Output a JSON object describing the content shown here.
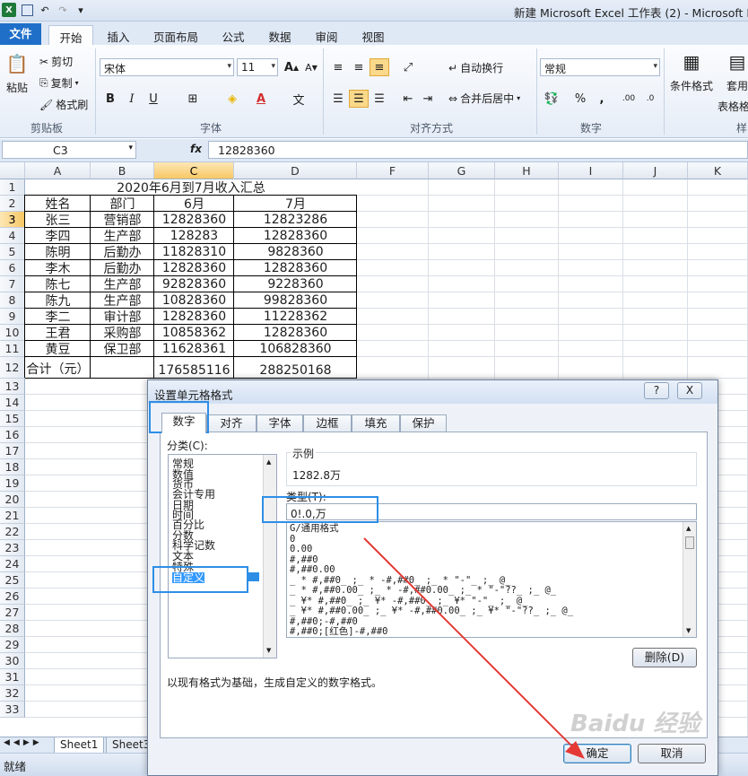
{
  "window": {
    "title": "新建 Microsoft Excel 工作表 (2) - Microsoft E"
  },
  "ribbon": {
    "tabs": [
      "文件",
      "开始",
      "插入",
      "页面布局",
      "公式",
      "数据",
      "审阅",
      "视图"
    ],
    "clipboard": {
      "paste": "粘贴",
      "cut": "剪切",
      "copy": "复制",
      "format_painter": "格式刷",
      "label": "剪贴板"
    },
    "font": {
      "name": "宋体",
      "size": "11",
      "label": "字体",
      "bold": "B",
      "italic": "I",
      "underline": "U"
    },
    "alignment": {
      "wrap": "自动换行",
      "merge": "合并后居中",
      "label": "对齐方式"
    },
    "number": {
      "format": "常规",
      "percent": "%",
      "comma": ",",
      "label": "数字"
    },
    "styles": {
      "conditional": "条件格式",
      "table": "套用",
      "table2": "表格格",
      "label": "样"
    }
  },
  "formula_bar": {
    "cell_ref": "C3",
    "fx": "fx",
    "value": "12828360"
  },
  "columns": [
    "A",
    "B",
    "C",
    "D",
    "F",
    "G",
    "H",
    "I",
    "J",
    "K"
  ],
  "rows": [
    "1",
    "2",
    "3",
    "4",
    "5",
    "6",
    "7",
    "8",
    "9",
    "10",
    "11",
    "12",
    "13",
    "14",
    "15",
    "16",
    "17",
    "18",
    "19",
    "20",
    "21",
    "22",
    "23",
    "24",
    "25",
    "26",
    "27",
    "28",
    "29",
    "30",
    "31",
    "32",
    "33"
  ],
  "sheet": {
    "title": "2020年6月到7月收入汇总",
    "headers": [
      "姓名",
      "部门",
      "6月",
      "7月"
    ],
    "data": [
      [
        "张三",
        "营销部",
        "12828360",
        "12823286"
      ],
      [
        "李四",
        "生产部",
        "128283",
        "12828360"
      ],
      [
        "陈明",
        "后勤办",
        "11828310",
        "9828360"
      ],
      [
        "李木",
        "后勤办",
        "12828360",
        "12828360"
      ],
      [
        "陈七",
        "生产部",
        "92828360",
        "9228360"
      ],
      [
        "陈九",
        "生产部",
        "10828360",
        "99828360"
      ],
      [
        "李二",
        "审计部",
        "12828360",
        "11228362"
      ],
      [
        "王君",
        "采购部",
        "10858362",
        "12828360"
      ],
      [
        "黄豆",
        "保卫部",
        "11628361",
        "106828360"
      ]
    ],
    "total": [
      "合计（元）",
      "",
      "176585116",
      "288250168"
    ]
  },
  "sheet_tabs": [
    "Sheet1",
    "Sheet3"
  ],
  "status": {
    "ready": "就绪"
  },
  "dialog": {
    "title": "设置单元格格式",
    "help": "?",
    "close": "X",
    "tabs": [
      "数字",
      "对齐",
      "字体",
      "边框",
      "填充",
      "保护"
    ],
    "category_label": "分类(C):",
    "categories": [
      "常规",
      "数值",
      "货币",
      "会计专用",
      "日期",
      "时间",
      "百分比",
      "分数",
      "科学记数",
      "文本",
      "特殊",
      "自定义"
    ],
    "sample_label": "示例",
    "sample_value": "1282.8万",
    "type_label": "类型(T):",
    "type_value": "0!.0,万",
    "formats": [
      "G/通用格式",
      "0",
      "0.00",
      "#,##0",
      "#,##0.00",
      "_ * #,##0_ ;_ * -#,##0_ ;_ * \"-\"_ ;_ @_",
      "_ * #,##0.00_ ;_ * -#,##0.00_ ;_ * \"-\"??_ ;_ @_",
      "_ ¥* #,##0_ ;_ ¥* -#,##0_ ;_ ¥* \"-\"_ ;_ @_",
      "_ ¥* #,##0.00_ ;_ ¥* -#,##0.00_ ;_ ¥* \"-\"??_ ;_ @_",
      "#,##0;-#,##0",
      "#,##0;[红色]-#,##0"
    ],
    "delete_button": "删除(D)",
    "description": "以现有格式为基础，生成自定义的数字格式。",
    "ok_button": "确定",
    "cancel_button": "取消"
  },
  "watermark": "Baidu 经验",
  "colors": {
    "highlight_box": "#2e8ee6",
    "arrow": "#e53935",
    "file_tab": "#1f6fc9"
  }
}
